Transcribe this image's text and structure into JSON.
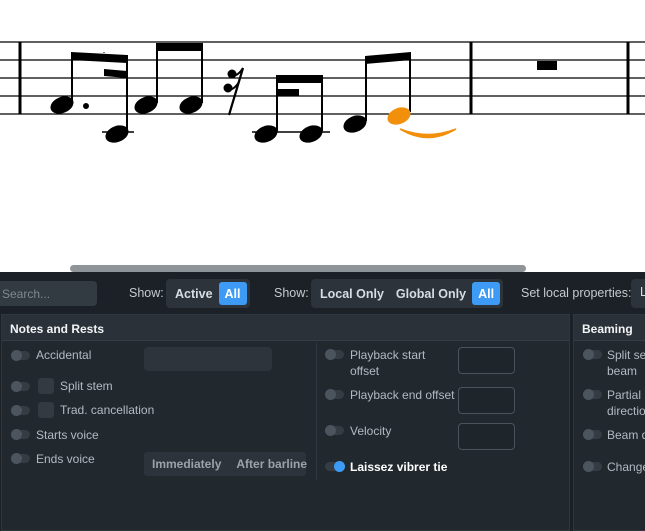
{
  "colors": {
    "accent": "#3e9bf5",
    "selected_note": "#f2900c",
    "panel_bg": "#1b2126"
  },
  "toolbar": {
    "search_placeholder": "Search...",
    "show1_label": "Show:",
    "show1_options": [
      "Active",
      "All"
    ],
    "show1_selected": "All",
    "show2_label": "Show:",
    "show2_options": [
      "Local Only",
      "Global Only",
      "All"
    ],
    "show2_selected": "All",
    "set_local_label": "Set local properties:",
    "set_local_value": "L"
  },
  "notes_and_rests": {
    "title": "Notes and Rests",
    "accidental": "Accidental",
    "split_stem": "Split stem",
    "trad_cancellation": "Trad. cancellation",
    "starts_voice": "Starts voice",
    "ends_voice": "Ends voice",
    "ends_voice_options": [
      "Immediately",
      "After barline"
    ],
    "playback_start_offset_1": "Playback start",
    "playback_start_offset_2": "offset",
    "playback_end_offset": "Playback end offset",
    "velocity": "Velocity",
    "laissez_vibrer_tie": "Laissez vibrer tie",
    "laissez_vibrer_tie_enabled": true
  },
  "beaming": {
    "title": "Beaming",
    "split_secondary_1": "Split sec",
    "split_secondary_2": "beam",
    "partial_beam_1": "Partial b",
    "partial_beam_2": "directio",
    "beam_d": "Beam d",
    "change": "Change"
  }
}
